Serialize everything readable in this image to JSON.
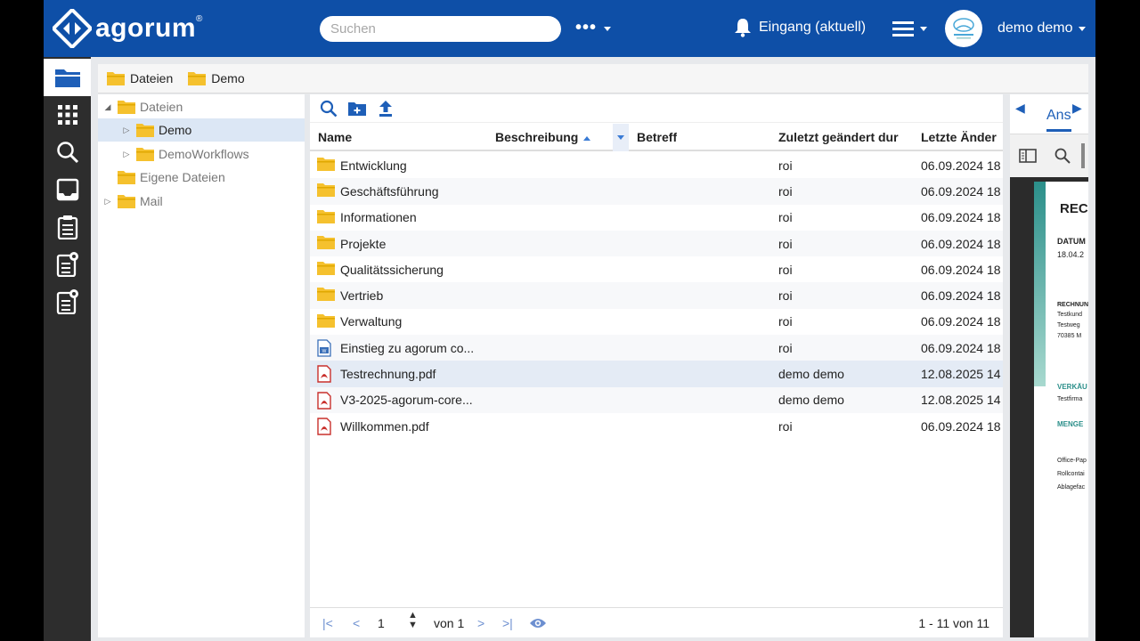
{
  "header": {
    "logo_text": "agorum",
    "logo_reg": "®",
    "search_placeholder": "Suchen",
    "more_label": "•••",
    "inbox_label": "Eingang (aktuell)",
    "user_name": "demo demo"
  },
  "breadcrumb": [
    "Dateien",
    "Demo"
  ],
  "tree": {
    "items": [
      {
        "label": "Dateien"
      },
      {
        "label": "Demo"
      },
      {
        "label": "DemoWorkflows"
      },
      {
        "label": "Eigene Dateien"
      },
      {
        "label": "Mail"
      }
    ]
  },
  "table": {
    "columns": [
      "Name",
      "Beschreibung",
      "Betreff",
      "Zuletzt geändert dur",
      "Letzte Änder"
    ],
    "rows": [
      {
        "name": "Entwicklung",
        "changed_by": "roi",
        "date": "06.09.2024 18",
        "type": "folder"
      },
      {
        "name": "Geschäftsführung",
        "changed_by": "roi",
        "date": "06.09.2024 18",
        "type": "folder"
      },
      {
        "name": "Informationen",
        "changed_by": "roi",
        "date": "06.09.2024 18",
        "type": "folder"
      },
      {
        "name": "Projekte",
        "changed_by": "roi",
        "date": "06.09.2024 18",
        "type": "folder"
      },
      {
        "name": "Qualitätssicherung",
        "changed_by": "roi",
        "date": "06.09.2024 18",
        "type": "folder"
      },
      {
        "name": "Vertrieb",
        "changed_by": "roi",
        "date": "06.09.2024 18",
        "type": "folder"
      },
      {
        "name": "Verwaltung",
        "changed_by": "roi",
        "date": "06.09.2024 18",
        "type": "folder"
      },
      {
        "name": "Einstieg zu agorum co...",
        "changed_by": "roi",
        "date": "06.09.2024 18",
        "type": "doc"
      },
      {
        "name": "Testrechnung.pdf",
        "changed_by": "demo demo",
        "date": "12.08.2025 14",
        "type": "pdf"
      },
      {
        "name": "V3-2025-agorum-core...",
        "changed_by": "demo demo",
        "date": "12.08.2025 14",
        "type": "pdf"
      },
      {
        "name": "Willkommen.pdf",
        "changed_by": "roi",
        "date": "06.09.2024 18",
        "type": "pdf"
      }
    ]
  },
  "pager": {
    "page": "1",
    "of_label": "von 1",
    "summary": "1 - 11 von 11"
  },
  "preview": {
    "tab_label": "Ans",
    "doc_lines": [
      "REC",
      "DATUM",
      "18.04.2",
      "RECHNUN",
      "Testkund",
      "Testweg",
      "70385 M",
      "VERKÄU",
      "Testfirma",
      "MENGE",
      "Office-Pap",
      "Rollcontai",
      "Ablagefac"
    ]
  },
  "colors": {
    "header_bg": "#0e4fa7",
    "nav_bg": "#2d2d2d",
    "folder": "#f5c12e",
    "pdf": "#c9302c",
    "accent": "#1e5fb8"
  }
}
